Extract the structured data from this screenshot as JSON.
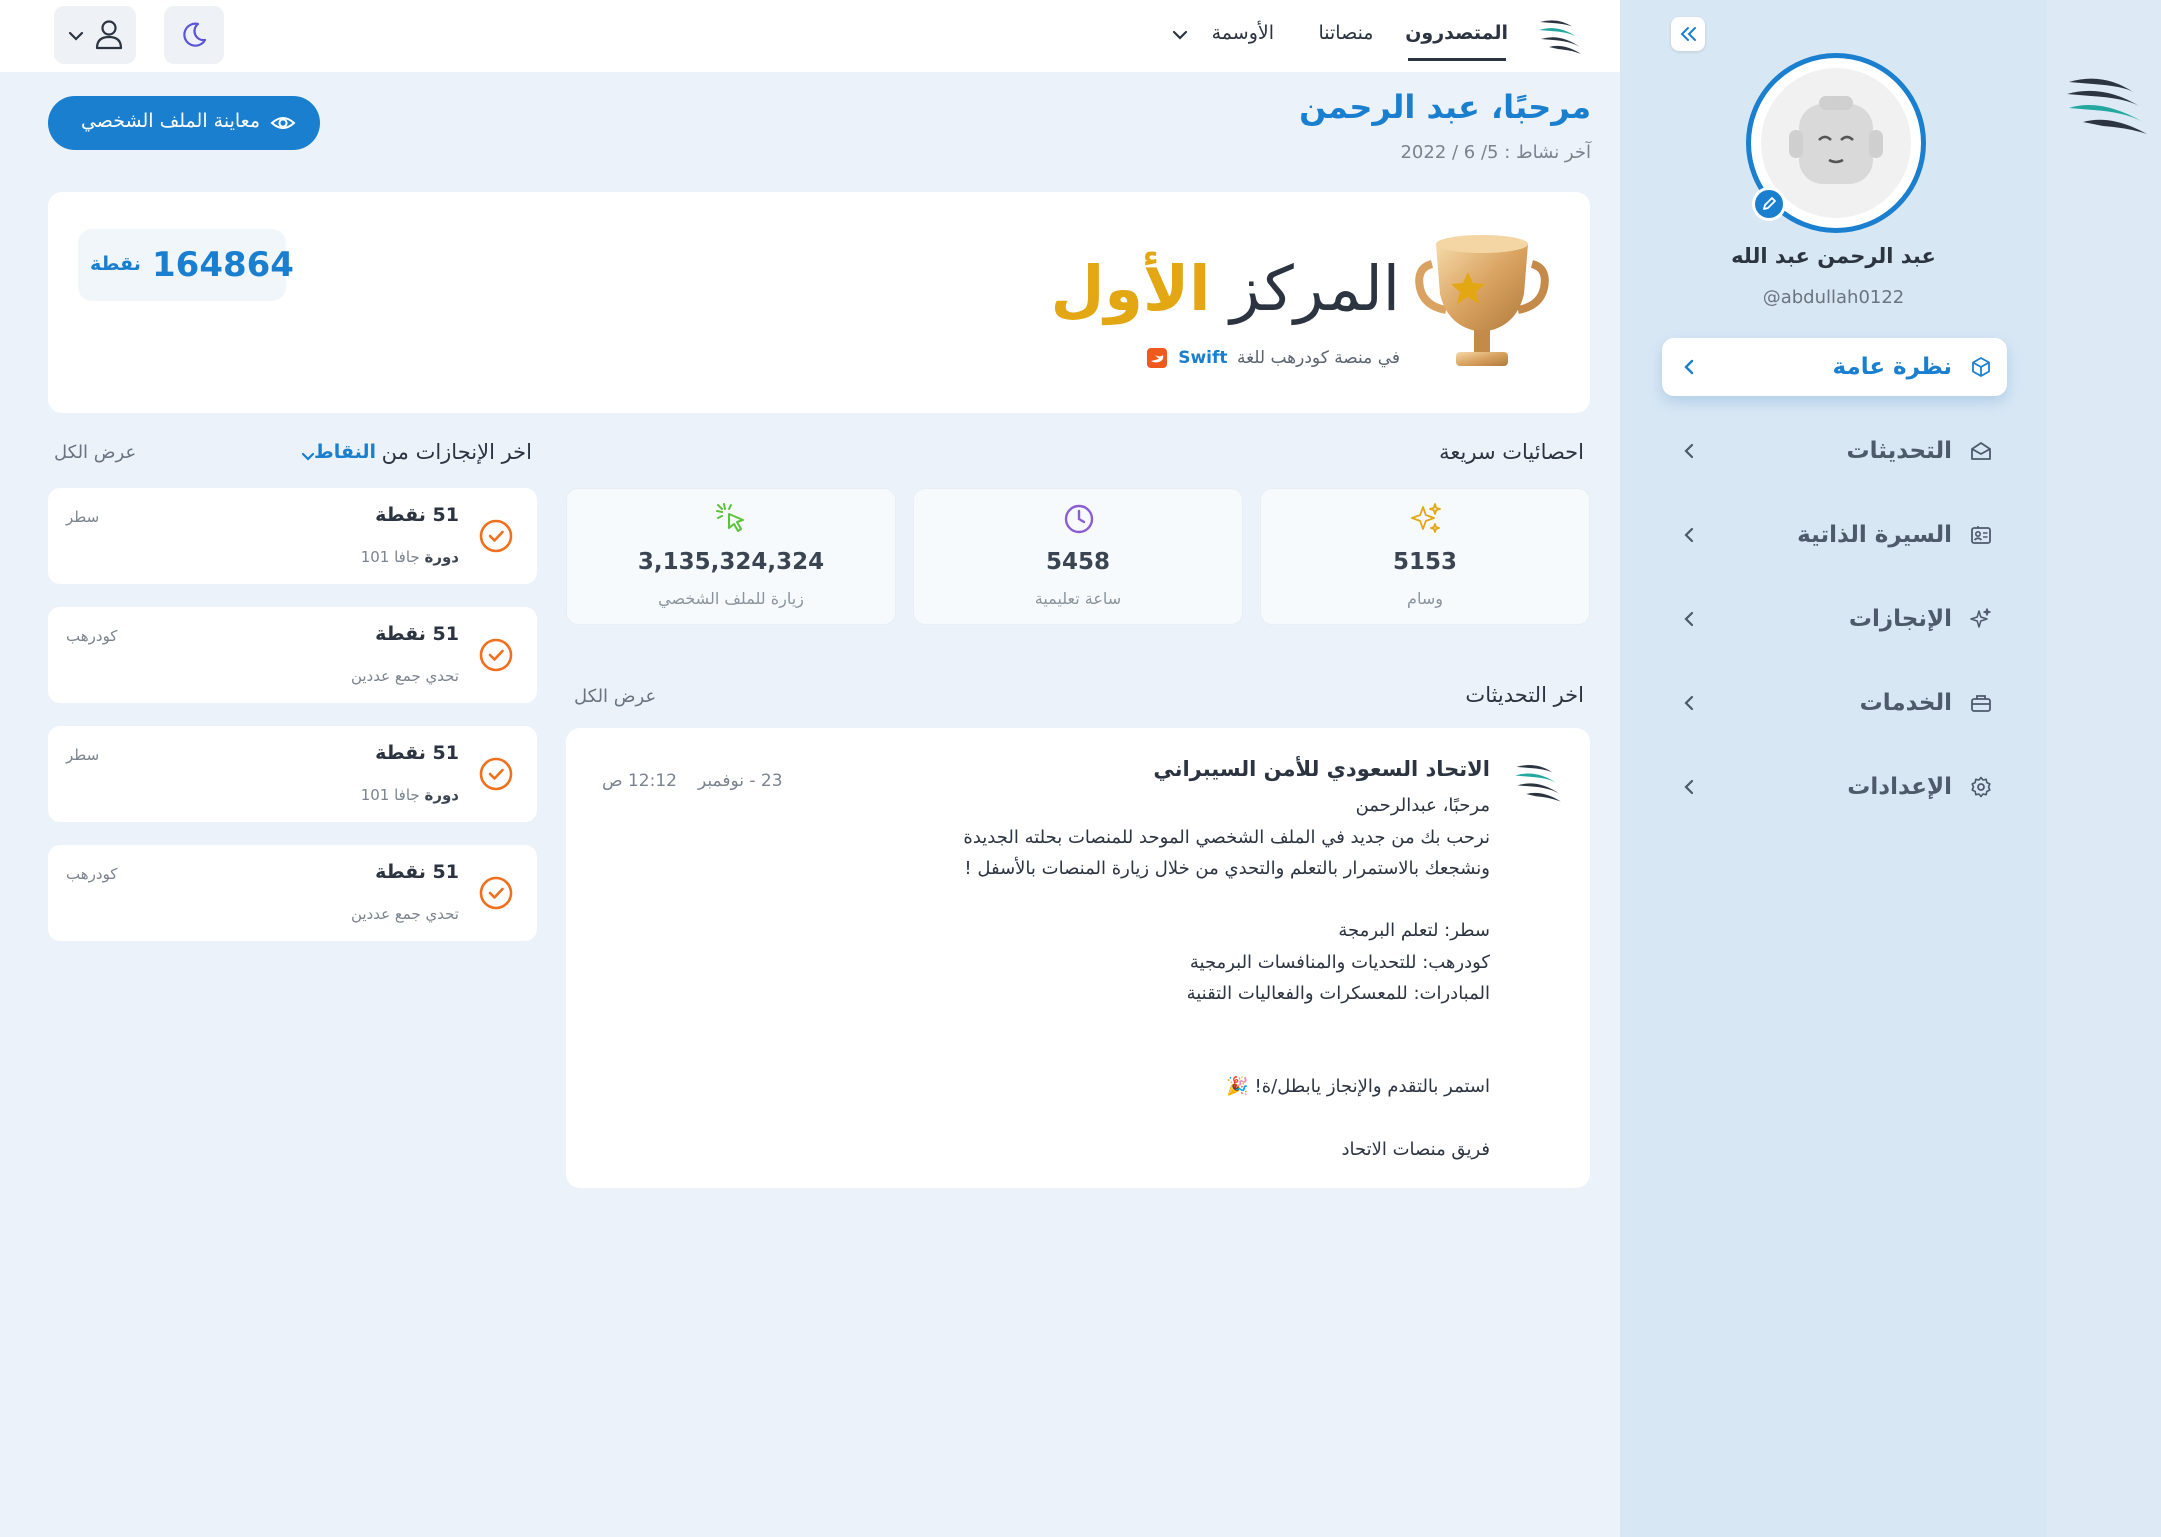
{
  "nav": {
    "leaderboard": "المتصدرون",
    "platforms": "منصاتنا",
    "badges": "الأوسمة"
  },
  "sidebar": {
    "name": "عبد الرحمن عبد الله",
    "handle": "@abdullah0122",
    "items": [
      {
        "label": "نظرة عامة",
        "icon": "cube-icon",
        "active": true
      },
      {
        "label": "التحديثات",
        "icon": "mail-open-icon",
        "active": false
      },
      {
        "label": "السيرة الذاتية",
        "icon": "id-card-icon",
        "active": false
      },
      {
        "label": "الإنجازات",
        "icon": "sparkle-icon",
        "active": false
      },
      {
        "label": "الخدمات",
        "icon": "briefcase-icon",
        "active": false
      },
      {
        "label": "الإعدادات",
        "icon": "gear-icon",
        "active": false
      }
    ]
  },
  "header": {
    "greeting": "مرحبًا، عبد الرحمن",
    "last_activity": "آخر نشاط : 5/ 6 / 2022",
    "preview_button": "معاينة الملف الشخصي"
  },
  "rank": {
    "title_prefix": "المركز",
    "title_highlight": "الأول",
    "subtitle": "في منصة كودرهب للغة",
    "language": "Swift",
    "points_value": "164864",
    "points_label": "نقطة"
  },
  "quick_stats": {
    "title": "احصائيات سريعة",
    "items": [
      {
        "value": "5153",
        "label": "وسام",
        "icon": "sparkles-icon"
      },
      {
        "value": "5458",
        "label": "ساعة تعليمية",
        "icon": "clock-icon"
      },
      {
        "value": "3,135,324,324",
        "label": "زيارة للملف الشخصي",
        "icon": "cursor-click-icon"
      }
    ]
  },
  "achievements": {
    "title": "اخر الإنجازات من",
    "filter": "النقاط",
    "view_all": "عرض الكل",
    "items": [
      {
        "points": "51 نقطة",
        "bold": "دورة",
        "detail": "جافا 101",
        "platform": "سطر"
      },
      {
        "points": "51 نقطة",
        "bold": "",
        "detail": "تحدي جمع عددين",
        "platform": "كودرهب"
      },
      {
        "points": "51 نقطة",
        "bold": "دورة",
        "detail": "جافا 101",
        "platform": "سطر"
      },
      {
        "points": "51 نقطة",
        "bold": "",
        "detail": "تحدي جمع عددين",
        "platform": "كودرهب"
      }
    ]
  },
  "updates": {
    "title": "اخر التحديثات",
    "view_all": "عرض الكل",
    "message": {
      "sender": "الاتحاد السعودي للأمن السيبراني",
      "date": "23 - نوفمبر",
      "time": "12:12 ص",
      "lines": [
        "مرحبًا، عبدالرحمن",
        "نرحب بك من جديد في الملف الشخصي الموحد للمنصات بحلته الجديدة",
        "ونشجعك بالاستمرار بالتعلم والتحدي من خلال زيارة المنصات بالأسفل !",
        "سطر: لتعلم البرمجة",
        "كودرهب: للتحديات والمنافسات البرمجية",
        "المبادرات: للمعسكرات والفعاليات التقنية",
        "استمر بالتقدم والإنجاز يابطل/ة! 🎉",
        "فريق منصات الاتحاد"
      ]
    }
  },
  "colors": {
    "primary": "#1a7fcf",
    "gold": "#e3a713",
    "orange": "#f0701e",
    "background": "#ebf2fa"
  }
}
